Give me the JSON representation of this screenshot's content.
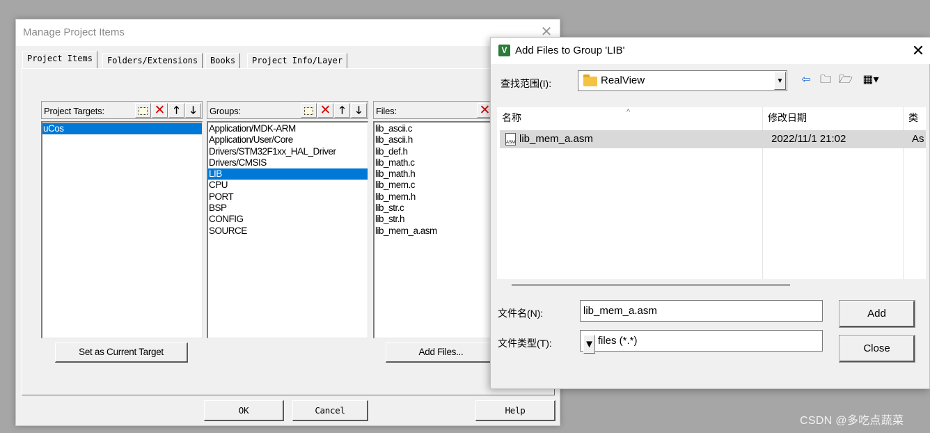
{
  "manage_dialog": {
    "title": "Manage Project Items",
    "tabs": [
      "Project Items",
      "Folders/Extensions",
      "Books",
      "Project Info/Layer"
    ],
    "project_targets": {
      "label": "Project Targets:",
      "items": [
        "uCos"
      ],
      "selected": "uCos"
    },
    "groups": {
      "label": "Groups:",
      "items": [
        "Application/MDK-ARM",
        "Application/User/Core",
        "Drivers/STM32F1xx_HAL_Driver",
        "Drivers/CMSIS",
        "LIB",
        "CPU",
        "PORT",
        "BSP",
        "CONFIG",
        "SOURCE"
      ],
      "selected": "LIB"
    },
    "files": {
      "label": "Files:",
      "items": [
        "lib_ascii.c",
        "lib_ascii.h",
        "lib_def.h",
        "lib_math.c",
        "lib_math.h",
        "lib_mem.c",
        "lib_mem.h",
        "lib_str.c",
        "lib_str.h",
        "lib_mem_a.asm"
      ]
    },
    "set_current_target_label": "Set as Current Target",
    "add_files_label": "Add Files...",
    "ok_label": "OK",
    "cancel_label": "Cancel",
    "help_label": "Help"
  },
  "add_files_dialog": {
    "title": "Add Files to Group 'LIB'",
    "look_in_label": "查找范围(I):",
    "look_in_value": "RealView",
    "columns": [
      "名称",
      "修改日期",
      "类"
    ],
    "files": [
      {
        "name": "lib_mem_a.asm",
        "date": "2022/11/1 21:02",
        "type": "As"
      }
    ],
    "filename_label": "文件名(N):",
    "filename_value": "lib_mem_a.asm",
    "filetype_label": "文件类型(T):",
    "filetype_value": "All files (*.*)",
    "add_label": "Add",
    "close_label": "Close"
  },
  "watermark": "CSDN @多吃点蔬菜",
  "colors": {
    "selection": "#0078d7",
    "delete_icon": "#d00000",
    "desktop": "#a6a6a6"
  }
}
